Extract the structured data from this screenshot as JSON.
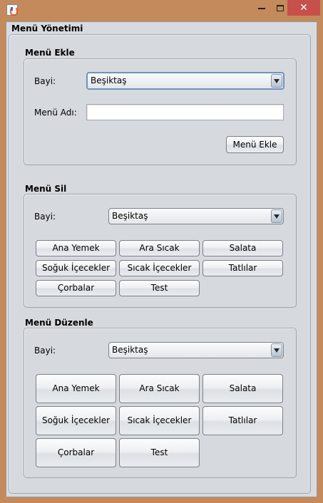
{
  "window": {
    "title": ""
  },
  "outer": {
    "title": "Menü Yönetimi"
  },
  "add": {
    "title": "Menü Ekle",
    "branch_label": "Bayi:",
    "branch_value": "Beşiktaş",
    "name_label": "Menü Adı:",
    "name_value": "",
    "button": "Menü Ekle"
  },
  "delete": {
    "title": "Menü Sil",
    "branch_label": "Bayi:",
    "branch_value": "Beşiktaş",
    "categories": [
      "Ana Yemek",
      "Ara Sıcak",
      "Salata",
      "Soğuk İçecekler",
      "Sıcak İçecekler",
      "Tatlılar",
      "Çorbalar",
      "Test"
    ]
  },
  "edit": {
    "title": "Menü Düzenle",
    "branch_label": "Bayi:",
    "branch_value": "Beşiktaş",
    "categories": [
      "Ana Yemek",
      "Ara Sıcak",
      "Salata",
      "Soğuk İçecekler",
      "Sıcak İçecekler",
      "Tatlılar",
      "Çorbalar",
      "Test"
    ]
  },
  "icons": {
    "app": "java-cup-icon",
    "minimize": "minimize-icon",
    "maximize": "maximize-icon",
    "close": "close-icon"
  },
  "colors": {
    "frame": "#c48a5b",
    "close_button": "#c7504a",
    "panel": "#d6d9de"
  }
}
